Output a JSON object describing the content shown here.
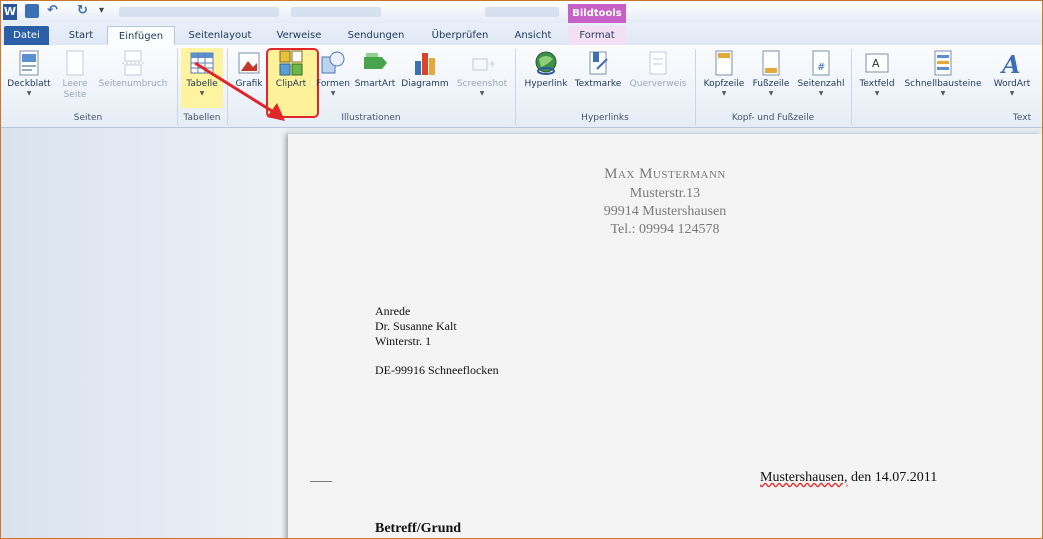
{
  "app": {
    "word_logo": "W",
    "tools_tab": "Bildtools"
  },
  "tabs": [
    "Datei",
    "Start",
    "Einfügen",
    "Seitenlayout",
    "Verweise",
    "Sendungen",
    "Überprüfen",
    "Ansicht",
    "Format"
  ],
  "ribbon": {
    "deckblatt": "Deckblatt",
    "leere_seite_1": "Leere",
    "leere_seite_2": "Seite",
    "seitenumbruch": "Seitenumbruch",
    "tabelle": "Tabelle",
    "grafik": "Grafik",
    "clipart": "ClipArt",
    "formen": "Formen",
    "smartart": "SmartArt",
    "diagramm": "Diagramm",
    "screenshot": "Screenshot",
    "hyperlink": "Hyperlink",
    "textmarke": "Textmarke",
    "querverweis": "Querverweis",
    "kopfzeile": "Kopfzeile",
    "fusszeile": "Fußzeile",
    "seitenzahl": "Seitenzahl",
    "textfeld": "Textfeld",
    "schnellbausteine": "Schnellbausteine",
    "wordart": "WordArt",
    "groups": [
      "Seiten",
      "Tabellen",
      "Illustrationen",
      "Hyperlinks",
      "Kopf- und Fußzeile",
      "Text"
    ]
  },
  "document": {
    "sender_name": "Max Mustermann",
    "sender_street": "Musterstr.13",
    "sender_city": "99914 Mustershausen",
    "sender_phone": "Tel.: 09994 124578",
    "recipient_1": "Anrede",
    "recipient_2": "Dr. Susanne Kalt",
    "recipient_3": "Winterstr. 1",
    "recipient_city": "DE-99916 Schneeflocken",
    "date_place": "Mustershausen,",
    "date_rest": " den 14.07.2011",
    "subject": "Betreff/Grund"
  },
  "colors": {
    "file_tab": "#2a5fa8",
    "tools_tab": "#c860c8",
    "highlight_border": "#e0262b",
    "highlight_fill": "#fdf19a"
  }
}
